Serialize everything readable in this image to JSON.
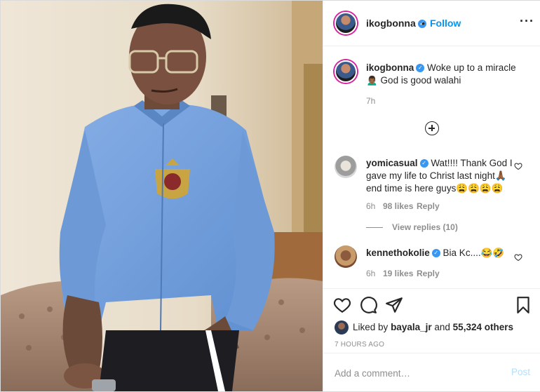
{
  "header": {
    "username": "ikogbonna",
    "follow_label": "Follow",
    "more_icon": "more-horizontal-icon"
  },
  "caption": {
    "username": "ikogbonna",
    "text": "Woke up to a miracle 🙍🏾‍♂️ God is good walahi",
    "time": "7h"
  },
  "comments": [
    {
      "username": "yomicasual",
      "text": "Wat!!!! Thank God I gave my life to Christ last night🙏🏾 end time is here guys😩😩😩😩",
      "time": "6h",
      "likes": "98 likes",
      "reply": "Reply",
      "view_replies": "View replies (10)"
    },
    {
      "username": "kennethokolie",
      "text": "Bia Kc....😂🤣",
      "time": "6h",
      "likes": "19 likes",
      "reply": "Reply"
    }
  ],
  "actions": {
    "liked_prefix": "Liked by",
    "liked_user": "bayala_jr",
    "liked_and": "and",
    "liked_others": "55,324 others",
    "timestamp": "7 HOURS AGO"
  },
  "add_comment": {
    "placeholder": "Add a comment…",
    "post_label": "Post"
  },
  "colors": {
    "accent": "#0095f6",
    "verified": "#3897f0",
    "muted": "#8e8e8e",
    "shirt": "#6d9ad6"
  }
}
